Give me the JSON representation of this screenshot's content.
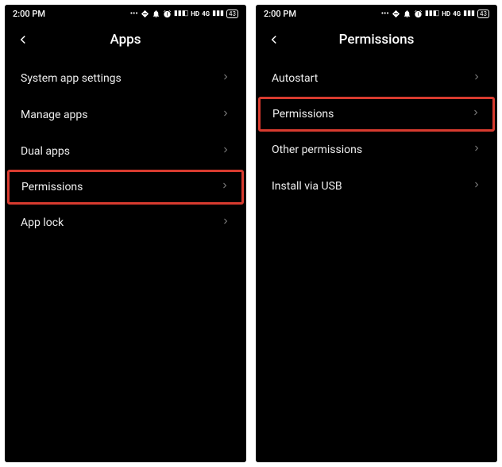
{
  "status": {
    "time": "2:00 PM",
    "battery": "43"
  },
  "screens": [
    {
      "title": "Apps",
      "items": [
        {
          "label": "System app settings",
          "highlighted": false
        },
        {
          "label": "Manage apps",
          "highlighted": false
        },
        {
          "label": "Dual apps",
          "highlighted": false
        },
        {
          "label": "Permissions",
          "highlighted": true
        },
        {
          "label": "App lock",
          "highlighted": false
        }
      ]
    },
    {
      "title": "Permissions",
      "items": [
        {
          "label": "Autostart",
          "highlighted": false
        },
        {
          "label": "Permissions",
          "highlighted": true
        },
        {
          "label": "Other permissions",
          "highlighted": false
        },
        {
          "label": "Install via USB",
          "highlighted": false
        }
      ]
    }
  ]
}
